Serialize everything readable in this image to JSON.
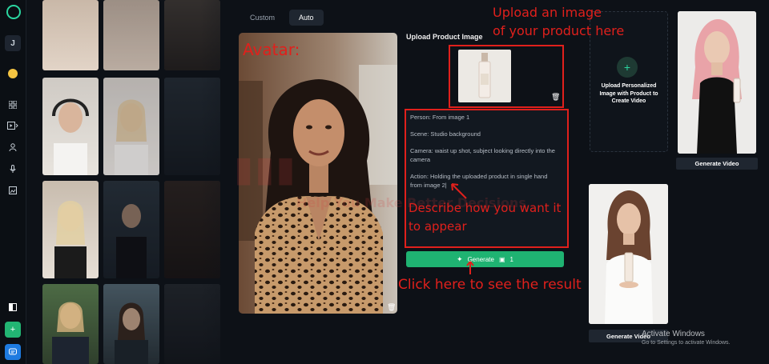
{
  "sidebar": {
    "user_initial": "J"
  },
  "tabs": [
    "Custom",
    "Auto"
  ],
  "avatar_label": "Avatar:",
  "upload": {
    "title": "Upload Product Image"
  },
  "prompt": {
    "lines": [
      "Person: From image 1",
      "Scene:  Studio background",
      "Camera: waist up shot, subject looking directly into the camera",
      "Action: Holding the uploaded product in single hand from image 2|"
    ]
  },
  "generate": {
    "label": "Generate",
    "credits": "1"
  },
  "upload_personal": {
    "text": "Upload Personalized Image with Product to Create Video"
  },
  "results": {
    "generate_video_label": "Generate Video"
  },
  "annotations": {
    "upload_hint_1": "Upload an image",
    "upload_hint_2": "of your product here",
    "describe_1": "Describe how you want it",
    "describe_2": "to appear",
    "click_here": "Click here to see the result"
  },
  "watermark": {
    "line1": "Help You Make Better Decisions"
  },
  "os": {
    "activate_title": "Activate Windows",
    "activate_sub": "Go to Settings to activate Windows."
  },
  "colors": {
    "accent_green": "#1fb372",
    "annotation_red": "#e0201c",
    "bg": "#0d1117"
  }
}
